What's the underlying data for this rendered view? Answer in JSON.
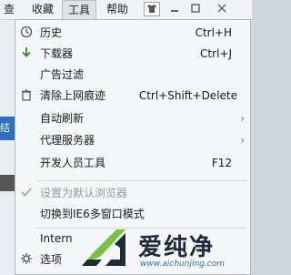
{
  "menubar": {
    "items": [
      "查看",
      "收藏",
      "工具",
      "帮助"
    ]
  },
  "left_strip": {
    "fragment": "结站"
  },
  "menu": {
    "items": [
      {
        "label": "历史",
        "shortcut": "Ctrl+H",
        "icon": "clock-icon"
      },
      {
        "label": "下载器",
        "shortcut": "Ctrl+J",
        "icon": "download-arrow-icon"
      },
      {
        "label": "广告过滤",
        "shortcut": "",
        "icon": ""
      },
      {
        "label": "清除上网痕迹",
        "shortcut": "Ctrl+Shift+Delete",
        "icon": "trash-icon"
      },
      {
        "label": "自动刷新",
        "shortcut": "",
        "icon": "",
        "submenu": true
      },
      {
        "label": "代理服务器",
        "shortcut": "",
        "icon": "",
        "submenu": true
      },
      {
        "label": "开发人员工具",
        "shortcut": "F12",
        "icon": ""
      },
      {
        "label": "设置为默认浏览器",
        "shortcut": "",
        "icon": "checkmark-icon",
        "disabled": true
      },
      {
        "label": "切换到IE6多窗口模式",
        "shortcut": "",
        "icon": ""
      },
      {
        "label": "Intern",
        "shortcut": "",
        "icon": ""
      },
      {
        "label": "选项",
        "shortcut": "",
        "icon": "gear-icon"
      }
    ]
  },
  "watermark": {
    "brand": "爱纯净",
    "url": "www.aichunjing.com"
  },
  "colors": {
    "menu_bg": "#f5f6f7",
    "disabled_text": "#9a9a9a",
    "check_green": "#8fbf8f",
    "logo_green": "#7ac143",
    "logo_blue": "#1d73c8"
  }
}
